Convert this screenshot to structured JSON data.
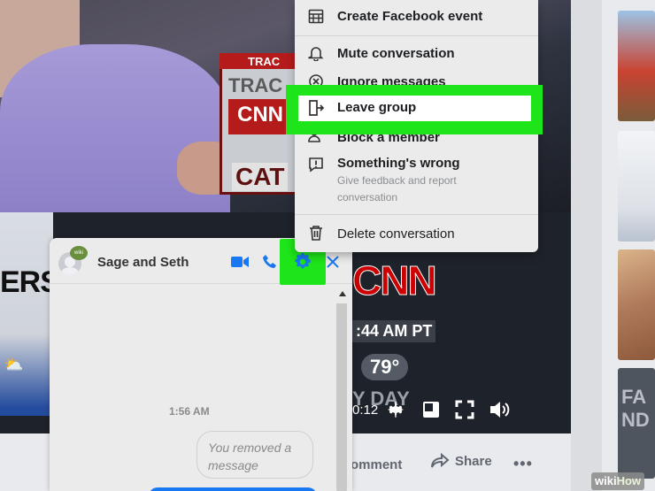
{
  "menu": {
    "items": [
      {
        "label": "Create Facebook event",
        "icon": "calendar-icon"
      },
      {
        "label": "Mute conversation",
        "icon": "bell-icon"
      },
      {
        "label": "Ignore messages",
        "icon": "ignore-icon"
      },
      {
        "label": "Leave group",
        "icon": "leave-icon"
      },
      {
        "label": "Block a member",
        "icon": "block-member-icon"
      },
      {
        "label": "Something's wrong",
        "sub": "Give feedback and report conversation",
        "icon": "alert-icon"
      },
      {
        "label": "Delete conversation",
        "icon": "trash-icon"
      }
    ],
    "highlight_color": "#1ee51a"
  },
  "chat": {
    "title": "Sage and Seth",
    "avatar_badge": "wiki",
    "time": "1:56 AM",
    "removed_message": "You removed a message",
    "accent": "#1877f2"
  },
  "video": {
    "tv_label_top": "TRAC",
    "tv_label_mid": "TRAC",
    "tv_label_cnn": "CNN",
    "tv_label_cat": "CAT",
    "left_text": "ERSE",
    "cnn_logo": "CNN",
    "clock": ":44 AM PT",
    "temperature": "79°",
    "day_text": "Y DAY",
    "playback_time": "0:12"
  },
  "actions": {
    "comment": "omment",
    "share": "Share",
    "more": "•••"
  },
  "thumbs": {
    "t4_text": "FA\nND"
  },
  "watermark": {
    "prefix": "wiki",
    "suffix": "How"
  }
}
